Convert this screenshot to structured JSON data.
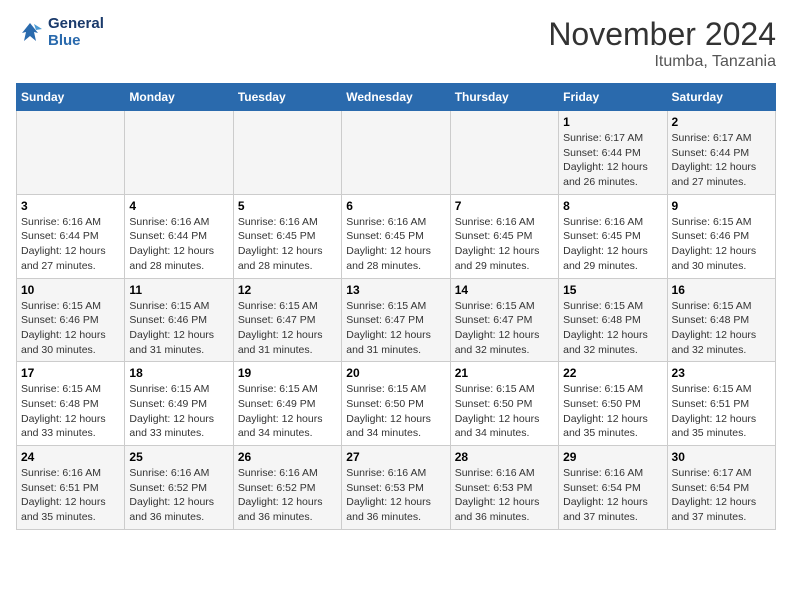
{
  "header": {
    "logo_line1": "General",
    "logo_line2": "Blue",
    "month_title": "November 2024",
    "subtitle": "Itumba, Tanzania"
  },
  "days_of_week": [
    "Sunday",
    "Monday",
    "Tuesday",
    "Wednesday",
    "Thursday",
    "Friday",
    "Saturday"
  ],
  "weeks": [
    [
      {
        "num": "",
        "info": ""
      },
      {
        "num": "",
        "info": ""
      },
      {
        "num": "",
        "info": ""
      },
      {
        "num": "",
        "info": ""
      },
      {
        "num": "",
        "info": ""
      },
      {
        "num": "1",
        "info": "Sunrise: 6:17 AM\nSunset: 6:44 PM\nDaylight: 12 hours and 26 minutes."
      },
      {
        "num": "2",
        "info": "Sunrise: 6:17 AM\nSunset: 6:44 PM\nDaylight: 12 hours and 27 minutes."
      }
    ],
    [
      {
        "num": "3",
        "info": "Sunrise: 6:16 AM\nSunset: 6:44 PM\nDaylight: 12 hours and 27 minutes."
      },
      {
        "num": "4",
        "info": "Sunrise: 6:16 AM\nSunset: 6:44 PM\nDaylight: 12 hours and 28 minutes."
      },
      {
        "num": "5",
        "info": "Sunrise: 6:16 AM\nSunset: 6:45 PM\nDaylight: 12 hours and 28 minutes."
      },
      {
        "num": "6",
        "info": "Sunrise: 6:16 AM\nSunset: 6:45 PM\nDaylight: 12 hours and 28 minutes."
      },
      {
        "num": "7",
        "info": "Sunrise: 6:16 AM\nSunset: 6:45 PM\nDaylight: 12 hours and 29 minutes."
      },
      {
        "num": "8",
        "info": "Sunrise: 6:16 AM\nSunset: 6:45 PM\nDaylight: 12 hours and 29 minutes."
      },
      {
        "num": "9",
        "info": "Sunrise: 6:15 AM\nSunset: 6:46 PM\nDaylight: 12 hours and 30 minutes."
      }
    ],
    [
      {
        "num": "10",
        "info": "Sunrise: 6:15 AM\nSunset: 6:46 PM\nDaylight: 12 hours and 30 minutes."
      },
      {
        "num": "11",
        "info": "Sunrise: 6:15 AM\nSunset: 6:46 PM\nDaylight: 12 hours and 31 minutes."
      },
      {
        "num": "12",
        "info": "Sunrise: 6:15 AM\nSunset: 6:47 PM\nDaylight: 12 hours and 31 minutes."
      },
      {
        "num": "13",
        "info": "Sunrise: 6:15 AM\nSunset: 6:47 PM\nDaylight: 12 hours and 31 minutes."
      },
      {
        "num": "14",
        "info": "Sunrise: 6:15 AM\nSunset: 6:47 PM\nDaylight: 12 hours and 32 minutes."
      },
      {
        "num": "15",
        "info": "Sunrise: 6:15 AM\nSunset: 6:48 PM\nDaylight: 12 hours and 32 minutes."
      },
      {
        "num": "16",
        "info": "Sunrise: 6:15 AM\nSunset: 6:48 PM\nDaylight: 12 hours and 32 minutes."
      }
    ],
    [
      {
        "num": "17",
        "info": "Sunrise: 6:15 AM\nSunset: 6:48 PM\nDaylight: 12 hours and 33 minutes."
      },
      {
        "num": "18",
        "info": "Sunrise: 6:15 AM\nSunset: 6:49 PM\nDaylight: 12 hours and 33 minutes."
      },
      {
        "num": "19",
        "info": "Sunrise: 6:15 AM\nSunset: 6:49 PM\nDaylight: 12 hours and 34 minutes."
      },
      {
        "num": "20",
        "info": "Sunrise: 6:15 AM\nSunset: 6:50 PM\nDaylight: 12 hours and 34 minutes."
      },
      {
        "num": "21",
        "info": "Sunrise: 6:15 AM\nSunset: 6:50 PM\nDaylight: 12 hours and 34 minutes."
      },
      {
        "num": "22",
        "info": "Sunrise: 6:15 AM\nSunset: 6:50 PM\nDaylight: 12 hours and 35 minutes."
      },
      {
        "num": "23",
        "info": "Sunrise: 6:15 AM\nSunset: 6:51 PM\nDaylight: 12 hours and 35 minutes."
      }
    ],
    [
      {
        "num": "24",
        "info": "Sunrise: 6:16 AM\nSunset: 6:51 PM\nDaylight: 12 hours and 35 minutes."
      },
      {
        "num": "25",
        "info": "Sunrise: 6:16 AM\nSunset: 6:52 PM\nDaylight: 12 hours and 36 minutes."
      },
      {
        "num": "26",
        "info": "Sunrise: 6:16 AM\nSunset: 6:52 PM\nDaylight: 12 hours and 36 minutes."
      },
      {
        "num": "27",
        "info": "Sunrise: 6:16 AM\nSunset: 6:53 PM\nDaylight: 12 hours and 36 minutes."
      },
      {
        "num": "28",
        "info": "Sunrise: 6:16 AM\nSunset: 6:53 PM\nDaylight: 12 hours and 36 minutes."
      },
      {
        "num": "29",
        "info": "Sunrise: 6:16 AM\nSunset: 6:54 PM\nDaylight: 12 hours and 37 minutes."
      },
      {
        "num": "30",
        "info": "Sunrise: 6:17 AM\nSunset: 6:54 PM\nDaylight: 12 hours and 37 minutes."
      }
    ]
  ]
}
